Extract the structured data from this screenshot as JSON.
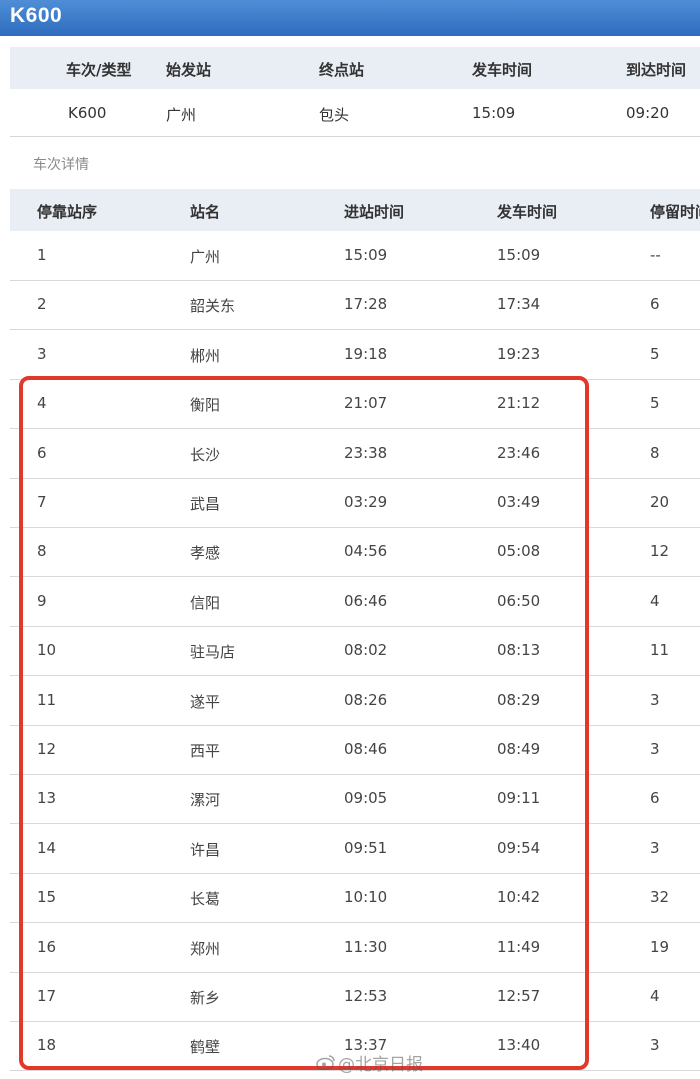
{
  "header": {
    "title": "K600"
  },
  "summary": {
    "columns": [
      "车次/类型",
      "始发站",
      "终点站",
      "发车时间",
      "到达时间"
    ],
    "values": [
      "K600",
      "广州",
      "包头",
      "15:09",
      "09:20"
    ]
  },
  "details": {
    "section_label": "车次详情",
    "columns": [
      "停靠站序",
      "站名",
      "进站时间",
      "发车时间",
      "停留时间"
    ],
    "rows": [
      [
        "1",
        "广州",
        "15:09",
        "15:09",
        "--"
      ],
      [
        "2",
        "韶关东",
        "17:28",
        "17:34",
        "6"
      ],
      [
        "3",
        "郴州",
        "19:18",
        "19:23",
        "5"
      ],
      [
        "4",
        "衡阳",
        "21:07",
        "21:12",
        "5"
      ],
      [
        "6",
        "长沙",
        "23:38",
        "23:46",
        "8"
      ],
      [
        "7",
        "武昌",
        "03:29",
        "03:49",
        "20"
      ],
      [
        "8",
        "孝感",
        "04:56",
        "05:08",
        "12"
      ],
      [
        "9",
        "信阳",
        "06:46",
        "06:50",
        "4"
      ],
      [
        "10",
        "驻马店",
        "08:02",
        "08:13",
        "11"
      ],
      [
        "11",
        "遂平",
        "08:26",
        "08:29",
        "3"
      ],
      [
        "12",
        "西平",
        "08:46",
        "08:49",
        "3"
      ],
      [
        "13",
        "漯河",
        "09:05",
        "09:11",
        "6"
      ],
      [
        "14",
        "许昌",
        "09:51",
        "09:54",
        "3"
      ],
      [
        "15",
        "长葛",
        "10:10",
        "10:42",
        "32"
      ],
      [
        "16",
        "郑州",
        "11:30",
        "11:49",
        "19"
      ],
      [
        "17",
        "新乡",
        "12:53",
        "12:57",
        "4"
      ],
      [
        "18",
        "鹤壁",
        "13:37",
        "13:40",
        "3"
      ]
    ]
  },
  "watermark": {
    "text": "@北京日报"
  },
  "colors": {
    "title_bar": "#3a7bd0",
    "highlight": "#e2382b",
    "header_bg": "#e9eef5"
  }
}
